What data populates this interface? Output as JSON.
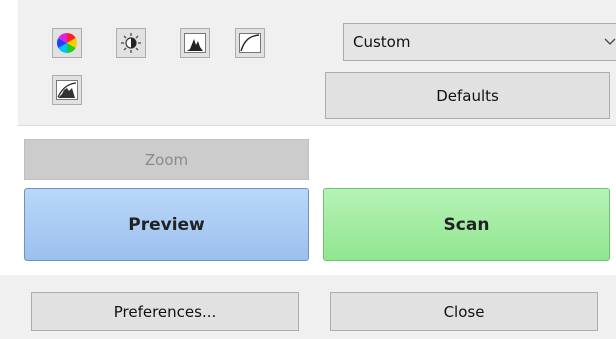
{
  "toolbar": {
    "icons": [
      "color-wheel",
      "brightness-contrast",
      "histogram",
      "tone-curve",
      "auto-levels"
    ]
  },
  "profile_select": {
    "value": "Custom"
  },
  "buttons": {
    "defaults": "Defaults",
    "zoom": "Zoom",
    "preview": "Preview",
    "scan": "Scan",
    "preferences": "Preferences...",
    "close": "Close"
  },
  "colors": {
    "preview_fill": "#a9ccf4",
    "scan_fill": "#a2ecA2",
    "zoom_disabled_fill": "#cccccc"
  }
}
